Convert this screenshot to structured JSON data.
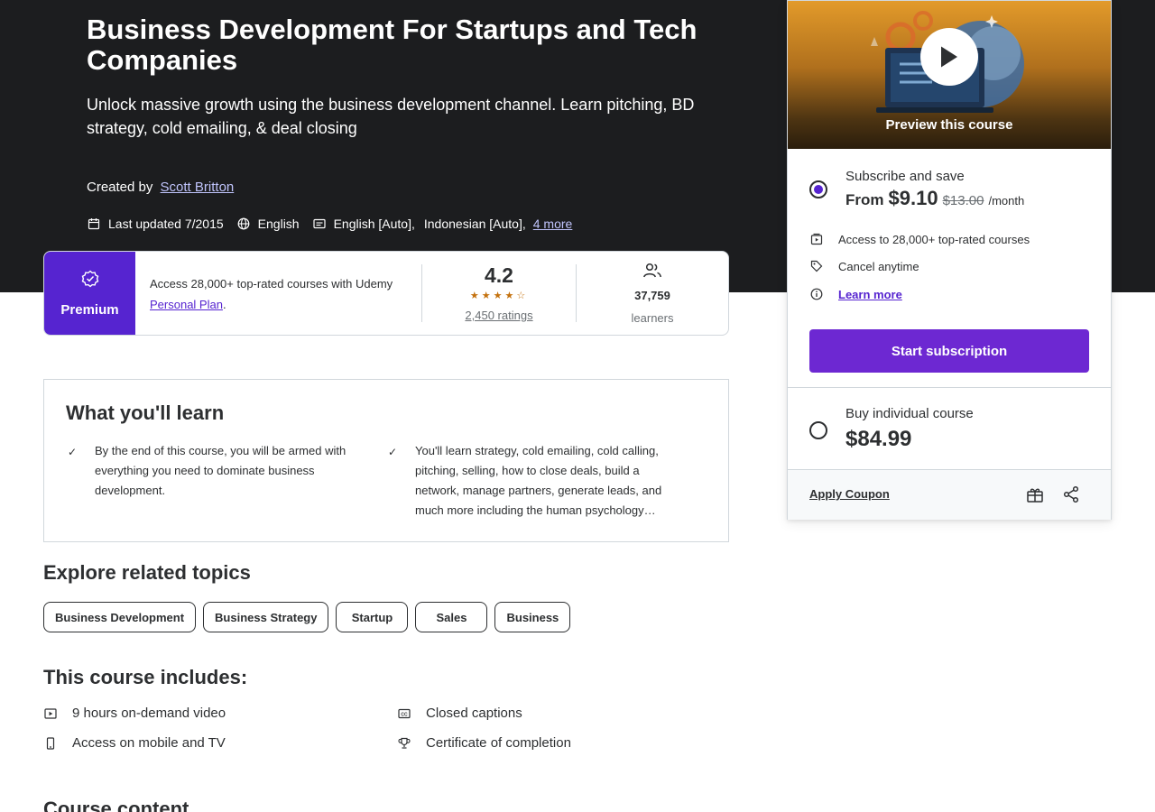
{
  "course": {
    "title": "Business Development For Startups and Tech Companies",
    "subtitle": "Unlock massive growth using the business development channel. Learn pitching, BD strategy, cold emailing, & deal closing",
    "created_by_label": "Created by",
    "instructor": "Scott Britton",
    "last_updated": "Last updated 7/2015",
    "language": "English",
    "captions": [
      "English [Auto],",
      "Indonesian [Auto],"
    ],
    "more_captions": "4 more"
  },
  "premium": {
    "badge_label": "Premium",
    "text_prefix": "Access 28,000+ top-rated courses with Udemy ",
    "plan_link": "Personal Plan",
    "text_suffix": ".",
    "rating": "4.2",
    "rating_stars": 4.2,
    "ratings_count": "2,450 ratings",
    "learners_count": "37,759",
    "learners_label": "learners"
  },
  "learn": {
    "title": "What you'll learn",
    "items": [
      "By the end of this course, you will be armed with everything you need to dominate business development.",
      "You'll learn strategy, cold emailing, cold calling, pitching, selling, how to close deals, build a network, manage partners, generate leads, and much more including the human psychology…"
    ]
  },
  "explore": {
    "title": "Explore related topics",
    "topics": [
      "Business Development",
      "Business Strategy",
      "Startup",
      "Sales",
      "Business"
    ]
  },
  "includes": {
    "title": "This course includes:",
    "items": [
      "9 hours on-demand video",
      "Closed captions",
      "Access on mobile and TV",
      "Certificate of completion"
    ]
  },
  "course_content": {
    "title": "Course content"
  },
  "sidebar": {
    "preview_label": "Preview this course",
    "subscribe": {
      "title": "Subscribe and save",
      "from_label": "From",
      "price": "$9.10",
      "old_price": "$13.00",
      "period": "/month",
      "features": [
        "Access to 28,000+ top-rated courses",
        "Cancel anytime",
        "Learn more"
      ],
      "button": "Start subscription"
    },
    "buy": {
      "title": "Buy individual course",
      "price": "$84.99"
    },
    "apply_coupon": "Apply Coupon"
  },
  "colors": {
    "accent": "#5624d0",
    "button": "#6d28d2",
    "hero_bg": "#1c1d1f",
    "star": "#c4710d"
  }
}
